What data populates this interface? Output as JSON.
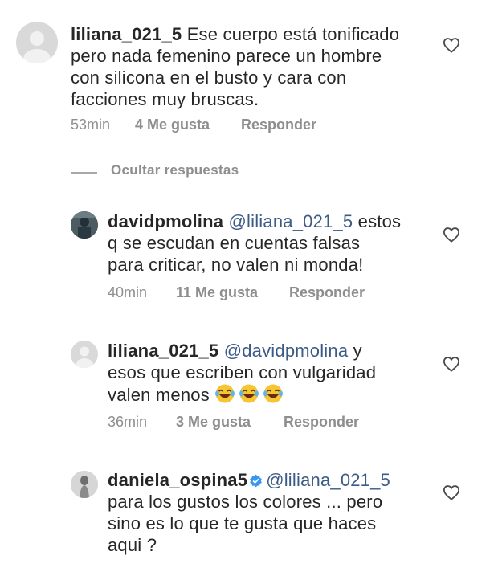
{
  "comments": [
    {
      "username": "liliana_021_5",
      "lines": [
        "Ese cuerpo está tonificado",
        "pero nada femenino parece un hombre",
        "con silicona en el busto y cara con",
        "facciones muy bruscas."
      ],
      "time": "53min",
      "likes": "4 Me gusta",
      "reply": "Responder"
    },
    {
      "username": "davidpmolina",
      "mention": "@liliana_021_5",
      "lines": [
        "estos",
        "q se escudan en cuentas falsas",
        "para criticar, no valen ni monda!"
      ],
      "time": "40min",
      "likes": "11 Me gusta",
      "reply": "Responder"
    },
    {
      "username": "liliana_021_5",
      "mention": "@davidpmolina",
      "lines": [
        "y",
        "esos que escriben con vulgaridad",
        "valen menos"
      ],
      "time": "36min",
      "likes": "3 Me gusta",
      "reply": "Responder"
    },
    {
      "username": "daniela_ospina5",
      "mention": "@liliana_021_5",
      "lines": [
        "para los gustos los colores ... pero",
        "sino es lo que te gusta que haces",
        "aqui ?"
      ],
      "verified": true
    }
  ],
  "hide_replies": "Ocultar respuestas",
  "colors": {
    "text": "#262626",
    "meta": "#8e8e8e",
    "mention": "#3b5b86",
    "verified": "#3897f0"
  },
  "icons": {
    "like": "heart-outline-icon",
    "verified": "verified-badge-icon",
    "emoji": "tears-of-joy-emoji"
  }
}
